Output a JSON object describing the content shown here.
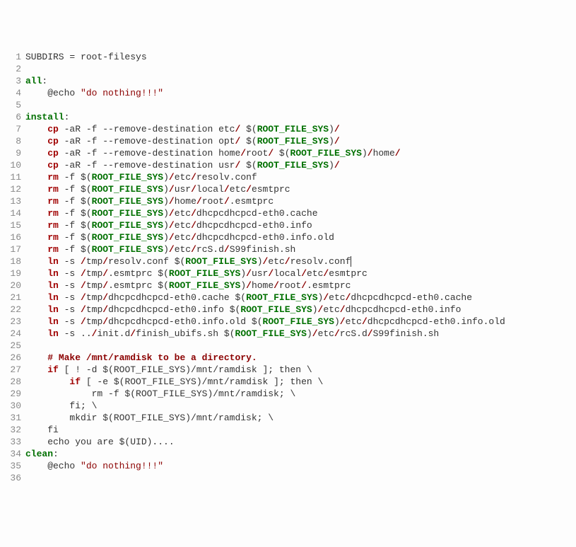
{
  "lines": [
    {
      "n": 1,
      "html": "SUBDIRS = root-filesys"
    },
    {
      "n": 2,
      "html": ""
    },
    {
      "n": 3,
      "html": "<span class='green'>all</span>:"
    },
    {
      "n": 4,
      "html": "    @echo <span class='str'>\"do nothing!!!\"</span>"
    },
    {
      "n": 5,
      "html": ""
    },
    {
      "n": 6,
      "html": "<span class='green'>install</span>:"
    },
    {
      "n": 7,
      "html": "    <span class='kw-red'>cp</span> -aR -f --remove-destination etc<span class='slash'>/</span> $(<span class='green'>ROOT_FILE_SYS</span>)<span class='slash'>/</span>"
    },
    {
      "n": 8,
      "html": "    <span class='kw-red'>cp</span> -aR -f --remove-destination opt<span class='slash'>/</span> $(<span class='green'>ROOT_FILE_SYS</span>)<span class='slash'>/</span>"
    },
    {
      "n": 9,
      "html": "    <span class='kw-red'>cp</span> -aR -f --remove-destination home<span class='slash'>/</span>root<span class='slash'>/</span> $(<span class='green'>ROOT_FILE_SYS</span>)<span class='slash'>/</span>home<span class='slash'>/</span>"
    },
    {
      "n": 10,
      "html": "    <span class='kw-red'>cp</span> -aR -f --remove-destination usr<span class='slash'>/</span> $(<span class='green'>ROOT_FILE_SYS</span>)<span class='slash'>/</span>"
    },
    {
      "n": 11,
      "html": "    <span class='kw-red'>rm</span> -f $(<span class='green'>ROOT_FILE_SYS</span>)<span class='slash'>/</span>etc<span class='slash'>/</span>resolv.conf"
    },
    {
      "n": 12,
      "html": "    <span class='kw-red'>rm</span> -f $(<span class='green'>ROOT_FILE_SYS</span>)<span class='slash'>/</span>usr<span class='slash'>/</span>local<span class='slash'>/</span>etc<span class='slash'>/</span>esmtprc"
    },
    {
      "n": 13,
      "html": "    <span class='kw-red'>rm</span> -f $(<span class='green'>ROOT_FILE_SYS</span>)<span class='slash'>/</span>home<span class='slash'>/</span>root<span class='slash'>/</span>.esmtprc"
    },
    {
      "n": 14,
      "html": "    <span class='kw-red'>rm</span> -f $(<span class='green'>ROOT_FILE_SYS</span>)<span class='slash'>/</span>etc<span class='slash'>/</span>dhcpcdhcpcd-eth0.cache"
    },
    {
      "n": 15,
      "html": "    <span class='kw-red'>rm</span> -f $(<span class='green'>ROOT_FILE_SYS</span>)<span class='slash'>/</span>etc<span class='slash'>/</span>dhcpcdhcpcd-eth0.info"
    },
    {
      "n": 16,
      "html": "    <span class='kw-red'>rm</span> -f $(<span class='green'>ROOT_FILE_SYS</span>)<span class='slash'>/</span>etc<span class='slash'>/</span>dhcpcdhcpcd-eth0.info.old"
    },
    {
      "n": 17,
      "html": "    <span class='kw-red'>rm</span> -f $(<span class='green'>ROOT_FILE_SYS</span>)<span class='slash'>/</span>etc<span class='slash'>/</span>rcS.d<span class='slash'>/</span>S99finish.sh"
    },
    {
      "n": 18,
      "html": "    <span class='kw-red'>ln</span> -s <span class='slash'>/</span>tmp<span class='slash'>/</span>resolv.conf $(<span class='green'>ROOT_FILE_SYS</span>)<span class='slash'>/</span>etc<span class='slash'>/</span>resolv.conf<span class='cursor'></span>"
    },
    {
      "n": 19,
      "html": "    <span class='kw-red'>ln</span> -s <span class='slash'>/</span>tmp<span class='slash'>/</span>.esmtprc $(<span class='green'>ROOT_FILE_SYS</span>)<span class='slash'>/</span>usr<span class='slash'>/</span>local<span class='slash'>/</span>etc<span class='slash'>/</span>esmtprc"
    },
    {
      "n": 20,
      "html": "    <span class='kw-red'>ln</span> -s <span class='slash'>/</span>tmp<span class='slash'>/</span>.esmtprc $(<span class='green'>ROOT_FILE_SYS</span>)<span class='slash'>/</span>home<span class='slash'>/</span>root<span class='slash'>/</span>.esmtprc"
    },
    {
      "n": 21,
      "html": "    <span class='kw-red'>ln</span> -s <span class='slash'>/</span>tmp<span class='slash'>/</span>dhcpcdhcpcd-eth0.cache $(<span class='green'>ROOT_FILE_SYS</span>)<span class='slash'>/</span>etc<span class='slash'>/</span>dhcpcdhcpcd-eth0.cache"
    },
    {
      "n": 22,
      "html": "    <span class='kw-red'>ln</span> -s <span class='slash'>/</span>tmp<span class='slash'>/</span>dhcpcdhcpcd-eth0.info $(<span class='green'>ROOT_FILE_SYS</span>)<span class='slash'>/</span>etc<span class='slash'>/</span>dhcpcdhcpcd-eth0.info"
    },
    {
      "n": 23,
      "html": "    <span class='kw-red'>ln</span> -s <span class='slash'>/</span>tmp<span class='slash'>/</span>dhcpcdhcpcd-eth0.info.old $(<span class='green'>ROOT_FILE_SYS</span>)<span class='slash'>/</span>etc<span class='slash'>/</span>dhcpcdhcpcd-eth0.info.old"
    },
    {
      "n": 24,
      "html": "    <span class='kw-red'>ln</span> -s ..<span class='slash'>/</span>init.d<span class='slash'>/</span>finish_ubifs.sh $(<span class='green'>ROOT_FILE_SYS</span>)<span class='slash'>/</span>etc<span class='slash'>/</span>rcS.d<span class='slash'>/</span>S99finish.sh"
    },
    {
      "n": 25,
      "html": ""
    },
    {
      "n": 26,
      "html": "    <span class='kw-darkred'># Make /mnt/ramdisk to be a directory.</span>"
    },
    {
      "n": 27,
      "html": "    <span class='kw-red'>if</span> [ ! -d $(ROOT_FILE_SYS)/mnt/ramdisk ]; then \\"
    },
    {
      "n": 28,
      "html": "        <span class='kw-red'>if</span> [ -e $(ROOT_FILE_SYS)/mnt/ramdisk ]; then \\"
    },
    {
      "n": 29,
      "html": "            rm -f $(ROOT_FILE_SYS)/mnt/ramdisk; \\"
    },
    {
      "n": 30,
      "html": "        fi; \\"
    },
    {
      "n": 31,
      "html": "        mkdir $(ROOT_FILE_SYS)/mnt/ramdisk; \\"
    },
    {
      "n": 32,
      "html": "    fi"
    },
    {
      "n": 33,
      "html": "    echo you are $(UID)...."
    },
    {
      "n": 34,
      "html": "<span class='green'>clean</span>:"
    },
    {
      "n": 35,
      "html": "    @echo <span class='str'>\"do nothing!!!\"</span>"
    },
    {
      "n": 36,
      "html": ""
    }
  ]
}
